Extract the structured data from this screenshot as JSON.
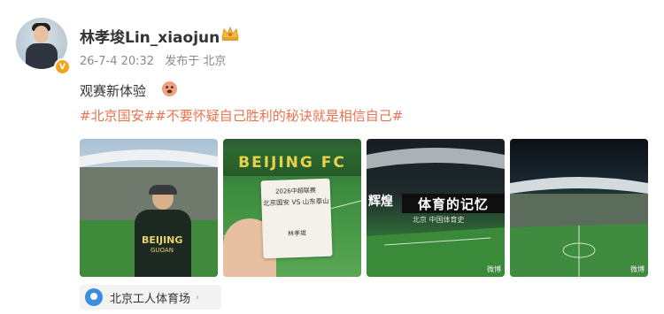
{
  "user": {
    "name": "林孝埈Lin_xiaojun",
    "verified_badge": "V"
  },
  "meta": {
    "date": "26-7-4 20:32",
    "location_prefix": "发布于 北京"
  },
  "post": {
    "text": "观赛新体验",
    "hashtags": "#北京国安##不要怀疑自己胜利的秘诀就是相信自己#"
  },
  "photos": {
    "p1_shirt": "BEIJING",
    "p1_shirt_sub": "GUOAN",
    "p2_banner": "BEIJING FC",
    "p2_ticket": {
      "line1": "2026中超联赛",
      "line2": "北京国安 VS 山东泰山",
      "line3": "",
      "line4": "林孝埈",
      "line5": ""
    },
    "p3_left": "辉煌",
    "p3_board": "体育的记忆",
    "p3_sub": "北京 中国体育史",
    "watermark": "微博"
  },
  "location": {
    "label": "北京工人体育场",
    "arrow": "›"
  },
  "colors": {
    "hashtag": "#eb7350",
    "location_pin": "#3c8ede",
    "badge": "#f3a31c"
  },
  "icons": {
    "crown": "crown-icon",
    "emoji": "emoji-icon",
    "location": "location-pin-icon"
  }
}
